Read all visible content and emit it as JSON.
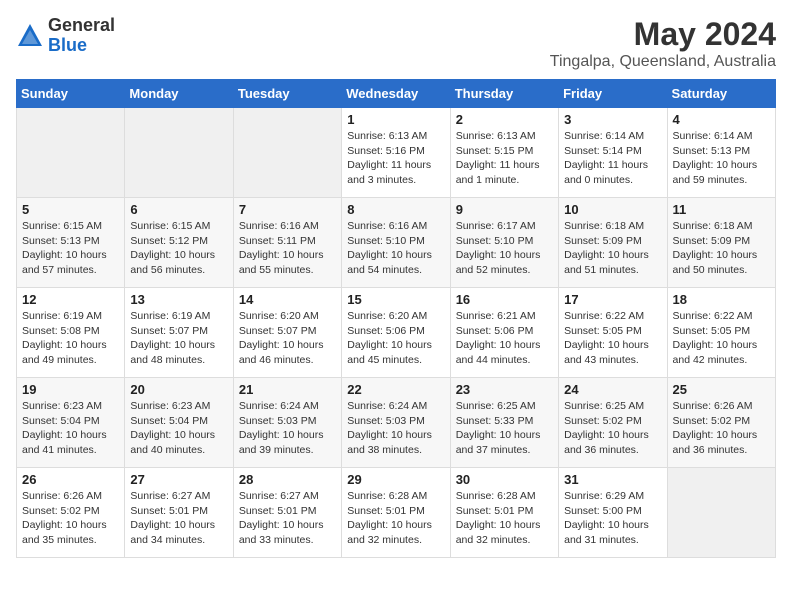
{
  "header": {
    "logo_general": "General",
    "logo_blue": "Blue",
    "title": "May 2024",
    "subtitle": "Tingalpa, Queensland, Australia"
  },
  "weekdays": [
    "Sunday",
    "Monday",
    "Tuesday",
    "Wednesday",
    "Thursday",
    "Friday",
    "Saturday"
  ],
  "weeks": [
    [
      {
        "day": "",
        "content": ""
      },
      {
        "day": "",
        "content": ""
      },
      {
        "day": "",
        "content": ""
      },
      {
        "day": "1",
        "content": "Sunrise: 6:13 AM\nSunset: 5:16 PM\nDaylight: 11 hours\nand 3 minutes."
      },
      {
        "day": "2",
        "content": "Sunrise: 6:13 AM\nSunset: 5:15 PM\nDaylight: 11 hours\nand 1 minute."
      },
      {
        "day": "3",
        "content": "Sunrise: 6:14 AM\nSunset: 5:14 PM\nDaylight: 11 hours\nand 0 minutes."
      },
      {
        "day": "4",
        "content": "Sunrise: 6:14 AM\nSunset: 5:13 PM\nDaylight: 10 hours\nand 59 minutes."
      }
    ],
    [
      {
        "day": "5",
        "content": "Sunrise: 6:15 AM\nSunset: 5:13 PM\nDaylight: 10 hours\nand 57 minutes."
      },
      {
        "day": "6",
        "content": "Sunrise: 6:15 AM\nSunset: 5:12 PM\nDaylight: 10 hours\nand 56 minutes."
      },
      {
        "day": "7",
        "content": "Sunrise: 6:16 AM\nSunset: 5:11 PM\nDaylight: 10 hours\nand 55 minutes."
      },
      {
        "day": "8",
        "content": "Sunrise: 6:16 AM\nSunset: 5:10 PM\nDaylight: 10 hours\nand 54 minutes."
      },
      {
        "day": "9",
        "content": "Sunrise: 6:17 AM\nSunset: 5:10 PM\nDaylight: 10 hours\nand 52 minutes."
      },
      {
        "day": "10",
        "content": "Sunrise: 6:18 AM\nSunset: 5:09 PM\nDaylight: 10 hours\nand 51 minutes."
      },
      {
        "day": "11",
        "content": "Sunrise: 6:18 AM\nSunset: 5:09 PM\nDaylight: 10 hours\nand 50 minutes."
      }
    ],
    [
      {
        "day": "12",
        "content": "Sunrise: 6:19 AM\nSunset: 5:08 PM\nDaylight: 10 hours\nand 49 minutes."
      },
      {
        "day": "13",
        "content": "Sunrise: 6:19 AM\nSunset: 5:07 PM\nDaylight: 10 hours\nand 48 minutes."
      },
      {
        "day": "14",
        "content": "Sunrise: 6:20 AM\nSunset: 5:07 PM\nDaylight: 10 hours\nand 46 minutes."
      },
      {
        "day": "15",
        "content": "Sunrise: 6:20 AM\nSunset: 5:06 PM\nDaylight: 10 hours\nand 45 minutes."
      },
      {
        "day": "16",
        "content": "Sunrise: 6:21 AM\nSunset: 5:06 PM\nDaylight: 10 hours\nand 44 minutes."
      },
      {
        "day": "17",
        "content": "Sunrise: 6:22 AM\nSunset: 5:05 PM\nDaylight: 10 hours\nand 43 minutes."
      },
      {
        "day": "18",
        "content": "Sunrise: 6:22 AM\nSunset: 5:05 PM\nDaylight: 10 hours\nand 42 minutes."
      }
    ],
    [
      {
        "day": "19",
        "content": "Sunrise: 6:23 AM\nSunset: 5:04 PM\nDaylight: 10 hours\nand 41 minutes."
      },
      {
        "day": "20",
        "content": "Sunrise: 6:23 AM\nSunset: 5:04 PM\nDaylight: 10 hours\nand 40 minutes."
      },
      {
        "day": "21",
        "content": "Sunrise: 6:24 AM\nSunset: 5:03 PM\nDaylight: 10 hours\nand 39 minutes."
      },
      {
        "day": "22",
        "content": "Sunrise: 6:24 AM\nSunset: 5:03 PM\nDaylight: 10 hours\nand 38 minutes."
      },
      {
        "day": "23",
        "content": "Sunrise: 6:25 AM\nSunset: 5:33 PM\nDaylight: 10 hours\nand 37 minutes."
      },
      {
        "day": "24",
        "content": "Sunrise: 6:25 AM\nSunset: 5:02 PM\nDaylight: 10 hours\nand 36 minutes."
      },
      {
        "day": "25",
        "content": "Sunrise: 6:26 AM\nSunset: 5:02 PM\nDaylight: 10 hours\nand 36 minutes."
      }
    ],
    [
      {
        "day": "26",
        "content": "Sunrise: 6:26 AM\nSunset: 5:02 PM\nDaylight: 10 hours\nand 35 minutes."
      },
      {
        "day": "27",
        "content": "Sunrise: 6:27 AM\nSunset: 5:01 PM\nDaylight: 10 hours\nand 34 minutes."
      },
      {
        "day": "28",
        "content": "Sunrise: 6:27 AM\nSunset: 5:01 PM\nDaylight: 10 hours\nand 33 minutes."
      },
      {
        "day": "29",
        "content": "Sunrise: 6:28 AM\nSunset: 5:01 PM\nDaylight: 10 hours\nand 32 minutes."
      },
      {
        "day": "30",
        "content": "Sunrise: 6:28 AM\nSunset: 5:01 PM\nDaylight: 10 hours\nand 32 minutes."
      },
      {
        "day": "31",
        "content": "Sunrise: 6:29 AM\nSunset: 5:00 PM\nDaylight: 10 hours\nand 31 minutes."
      },
      {
        "day": "",
        "content": ""
      }
    ]
  ]
}
